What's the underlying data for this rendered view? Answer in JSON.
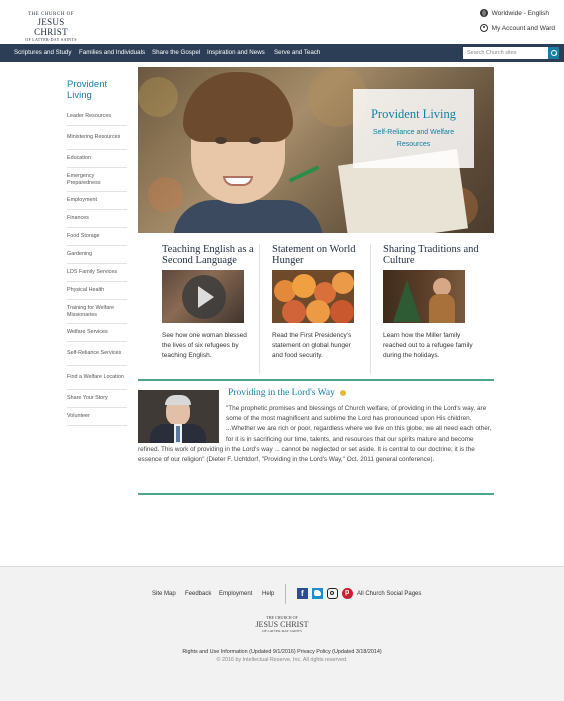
{
  "header": {
    "logo": {
      "line1": "THE CHURCH OF",
      "line2": "JESUS CHRIST",
      "line3": "OF LATTER-DAY SAINTS"
    },
    "language": "Worldwide - English",
    "account": "My Account and Ward"
  },
  "nav": {
    "items": [
      "Scriptures and Study",
      "Families and Individuals",
      "Share the Gospel",
      "Inspiration and News",
      "Serve and Teach"
    ],
    "search_placeholder": "Search Church sites"
  },
  "sidebar": {
    "title": "Provident Living",
    "items": [
      "Leader Resources",
      "Ministering Resources",
      "Education",
      "Emergency Preparedness",
      "Employment",
      "Finances",
      "Food Storage",
      "Gardening",
      "LDS Family Services",
      "Physical Health",
      "Training for Welfare Missionaries",
      "Welfare Services",
      "Self-Reliance Services",
      "Find a Welfare Location",
      "Share Your Story",
      "Volunteer"
    ]
  },
  "hero": {
    "title": "Provident Living",
    "subtitle": "Self-Reliance and Welfare Resources"
  },
  "features": [
    {
      "title": "Teaching English as a Second Language",
      "text": "See how one woman blessed the lives of six refugees by teaching English."
    },
    {
      "title": "Statement on World Hunger",
      "text": "Read the First Presidency's statement on global hunger and food security."
    },
    {
      "title": "Sharing Traditions and Culture",
      "text": "Learn how the Miller family reached out to a refugee family during the holidays."
    }
  ],
  "quote": {
    "title": "Providing in the Lord's Way",
    "text": "\"The prophetic promises and blessings of Church welfare, of providing in the Lord's way, are some of the most magnificent and sublime the Lord has pronounced upon His children. ...Whether we are rich or poor, regardless where we live on this globe, we all need each other, for it is in sacrificing our time, talents, and resources that our spirits mature and become refined. This work of providing in the Lord's way ... cannot be neglected or set aside. It is central to our doctrine; it is the essence of our religion\" (Dieter F. Uchtdorf, \"Providing in the Lord's Way,\" Oct. 2011 general conference)."
  },
  "footer": {
    "links": [
      "Site Map",
      "Feedback",
      "Employment",
      "Help"
    ],
    "social_label": "All Church Social Pages",
    "logo": {
      "line1": "THE CHURCH OF",
      "line2": "JESUS CHRIST",
      "line3": "OF LATTER-DAY SAINTS"
    },
    "legal": "Rights and Use Information (Updated 9/1/2016) Privacy Policy (Updated 3/18/2014)",
    "copyright": "© 2016 by Intellectual Reserve, Inc. All rights reserved."
  },
  "colors": {
    "nav": "#2c3e55",
    "accent": "#157ea2",
    "rule": "#4aa58b"
  }
}
